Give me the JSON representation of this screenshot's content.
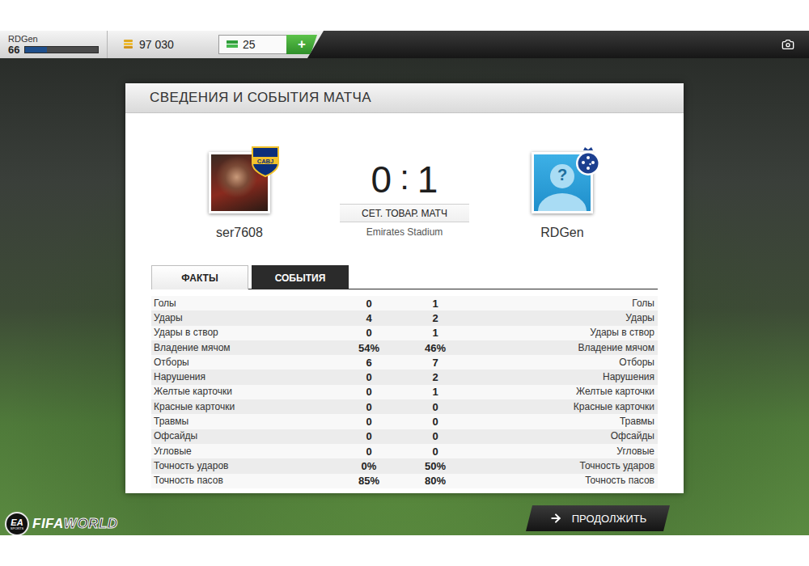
{
  "top_bar": {
    "player": {
      "name": "RDGen",
      "level": "66",
      "xp_level": 0.3
    },
    "coins": "97 030",
    "points": "25",
    "add_label": "+"
  },
  "panel": {
    "title": "СВЕДЕНИЯ И СОБЫТИЯ МАТЧА"
  },
  "match": {
    "home": {
      "name": "ser7608",
      "badge_text": "CABJ"
    },
    "away": {
      "name": "RDGen",
      "avatar_glyph": "?"
    },
    "score": {
      "home": "0",
      "separator": ":",
      "away": "1"
    },
    "match_type": "СЕТ. ТОВАР. МАТЧ",
    "stadium": "Emirates Stadium"
  },
  "tabs": [
    {
      "label": "ФАКТЫ",
      "selected": true
    },
    {
      "label": "СОБЫТИЯ",
      "selected": false
    }
  ],
  "stats": [
    {
      "label": "Голы",
      "home": "0",
      "away": "1"
    },
    {
      "label": "Удары",
      "home": "4",
      "away": "2"
    },
    {
      "label": "Удары в створ",
      "home": "0",
      "away": "1"
    },
    {
      "label": "Владение мячом",
      "home": "54%",
      "away": "46%"
    },
    {
      "label": "Отборы",
      "home": "6",
      "away": "7"
    },
    {
      "label": "Нарушения",
      "home": "0",
      "away": "2"
    },
    {
      "label": "Желтые карточки",
      "home": "0",
      "away": "1"
    },
    {
      "label": "Красные карточки",
      "home": "0",
      "away": "0"
    },
    {
      "label": "Травмы",
      "home": "0",
      "away": "0"
    },
    {
      "label": "Офсайды",
      "home": "0",
      "away": "0"
    },
    {
      "label": "Угловые",
      "home": "0",
      "away": "0"
    },
    {
      "label": "Точность ударов",
      "home": "0%",
      "away": "50%"
    },
    {
      "label": "Точность пасов",
      "home": "85%",
      "away": "80%"
    }
  ],
  "footer": {
    "logo": {
      "badge": "EA",
      "badge_sub": "SPORTS",
      "word1": "FIFA",
      "word2": "WORLD"
    },
    "continue_button": {
      "label": "ПРОДОЛЖИТЬ"
    }
  }
}
